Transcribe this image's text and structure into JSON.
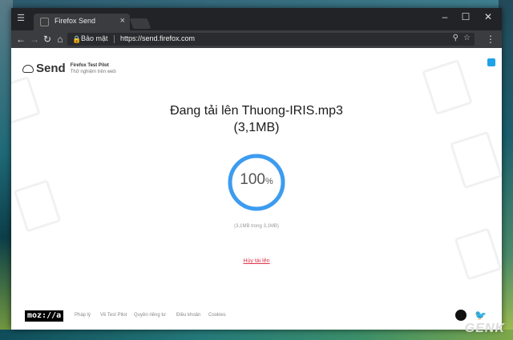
{
  "browser": {
    "tab_title": "Firefox Send",
    "secure_label": "Bảo mật",
    "url": "https://send.firefox.com"
  },
  "site": {
    "logo_text": "Send",
    "logo_sub1": "Firefox Test Pilot",
    "logo_sub2": "Thử nghiệm trên web"
  },
  "upload": {
    "title_line1": "Đang tải lên Thuong-IRIS.mp3",
    "title_line2": "(3,1MB)",
    "percent_value": "100",
    "percent_sign": "%",
    "progress": 1.0,
    "size_text": "(3,1MB trong 3,1MB)",
    "cancel_label": "Hủy tải lên"
  },
  "footer": {
    "mozilla_logo": "moz://a",
    "links": [
      "Pháp lý",
      "Về Test Pilot",
      "Quyền riêng tư",
      "Điều khoản",
      "Cookies"
    ]
  },
  "watermark": "GENK",
  "colors": {
    "accent": "#3d9cf0",
    "cancel": "#e0344a",
    "chrome_dark": "#222326"
  }
}
